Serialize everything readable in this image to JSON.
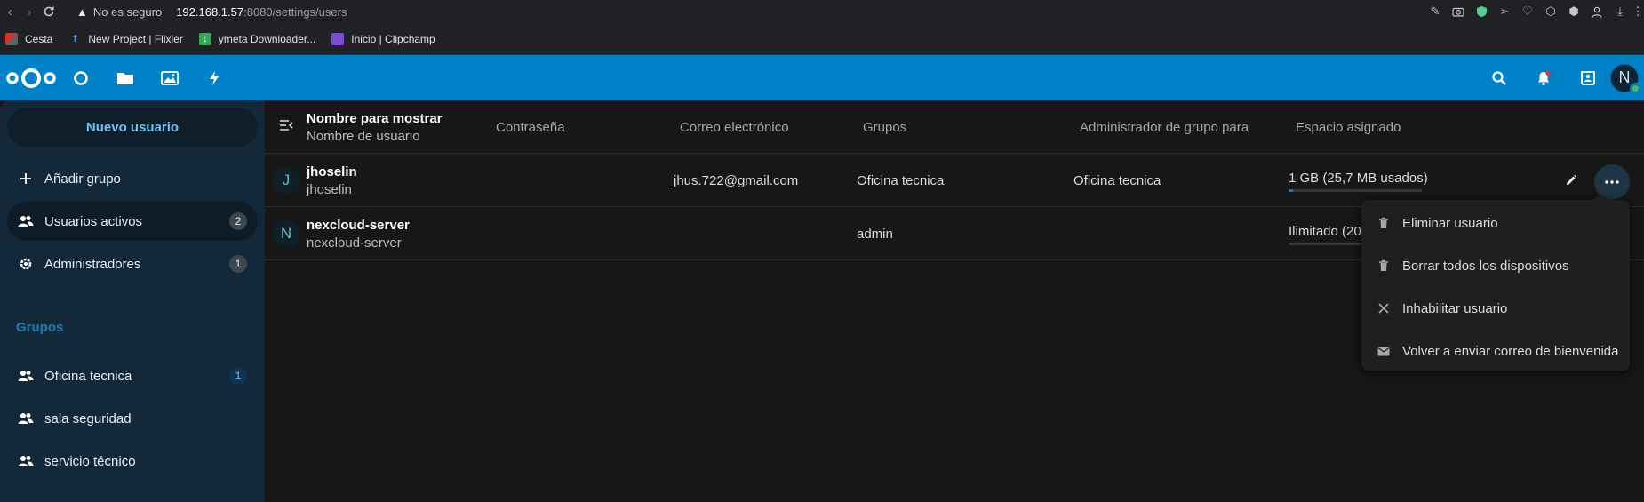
{
  "browser": {
    "insecure_label": "No es seguro",
    "url_host": "192.168.1.57",
    "url_rest": ":8080/settings/users",
    "bookmarks": [
      {
        "label": "Cesta",
        "icon": "cart-icon"
      },
      {
        "label": "New Project | Flixier",
        "icon": "flixier-icon"
      },
      {
        "label": "ymeta Downloader...",
        "icon": "download-icon"
      },
      {
        "label": "Inicio | Clipchamp",
        "icon": "clipchamp-icon"
      }
    ]
  },
  "header": {
    "apps": [
      "dashboard-icon",
      "files-icon",
      "photos-icon",
      "activity-icon"
    ],
    "avatar_letter": "N"
  },
  "sidebar": {
    "new_user": "Nuevo usuario",
    "add_group": "Añadir grupo",
    "active_users": {
      "label": "Usuarios activos",
      "count": "2"
    },
    "admins": {
      "label": "Administradores",
      "count": "1"
    },
    "groups_caption": "Grupos",
    "groups": [
      {
        "label": "Oficina tecnica",
        "count": "1"
      },
      {
        "label": "sala seguridad",
        "count": ""
      },
      {
        "label": "servicio técnico",
        "count": ""
      }
    ]
  },
  "table": {
    "headers": {
      "display_name": "Nombre para mostrar",
      "username": "Nombre de usuario",
      "password": "Contraseña",
      "email": "Correo electrónico",
      "groups": "Grupos",
      "group_admin": "Administrador de grupo para",
      "quota": "Espacio asignado"
    },
    "rows": [
      {
        "avatar": "J",
        "display_name": "jhoselin",
        "username": "jhoselin",
        "email": "jhus.722@gmail.com",
        "groups": "Oficina tecnica",
        "group_admin": "Oficina tecnica",
        "quota": "1 GB (25,7 MB usados)",
        "quota_fraction": 0.03
      },
      {
        "avatar": "N",
        "display_name": "nexcloud-server",
        "username": "nexcloud-server",
        "email": "",
        "groups": "admin",
        "group_admin": "",
        "quota": "Ilimitado (20",
        "quota_fraction": 0.0
      }
    ]
  },
  "menu": {
    "items": [
      {
        "label": "Eliminar usuario",
        "icon": "trash-icon"
      },
      {
        "label": "Borrar todos los dispositivos",
        "icon": "trash-icon"
      },
      {
        "label": "Inhabilitar usuario",
        "icon": "close-icon"
      },
      {
        "label": "Volver a enviar correo de bienvenida",
        "icon": "mail-icon"
      }
    ]
  },
  "colors": {
    "brand": "#0082c9",
    "sidebar": "#132838",
    "background": "#171717"
  }
}
